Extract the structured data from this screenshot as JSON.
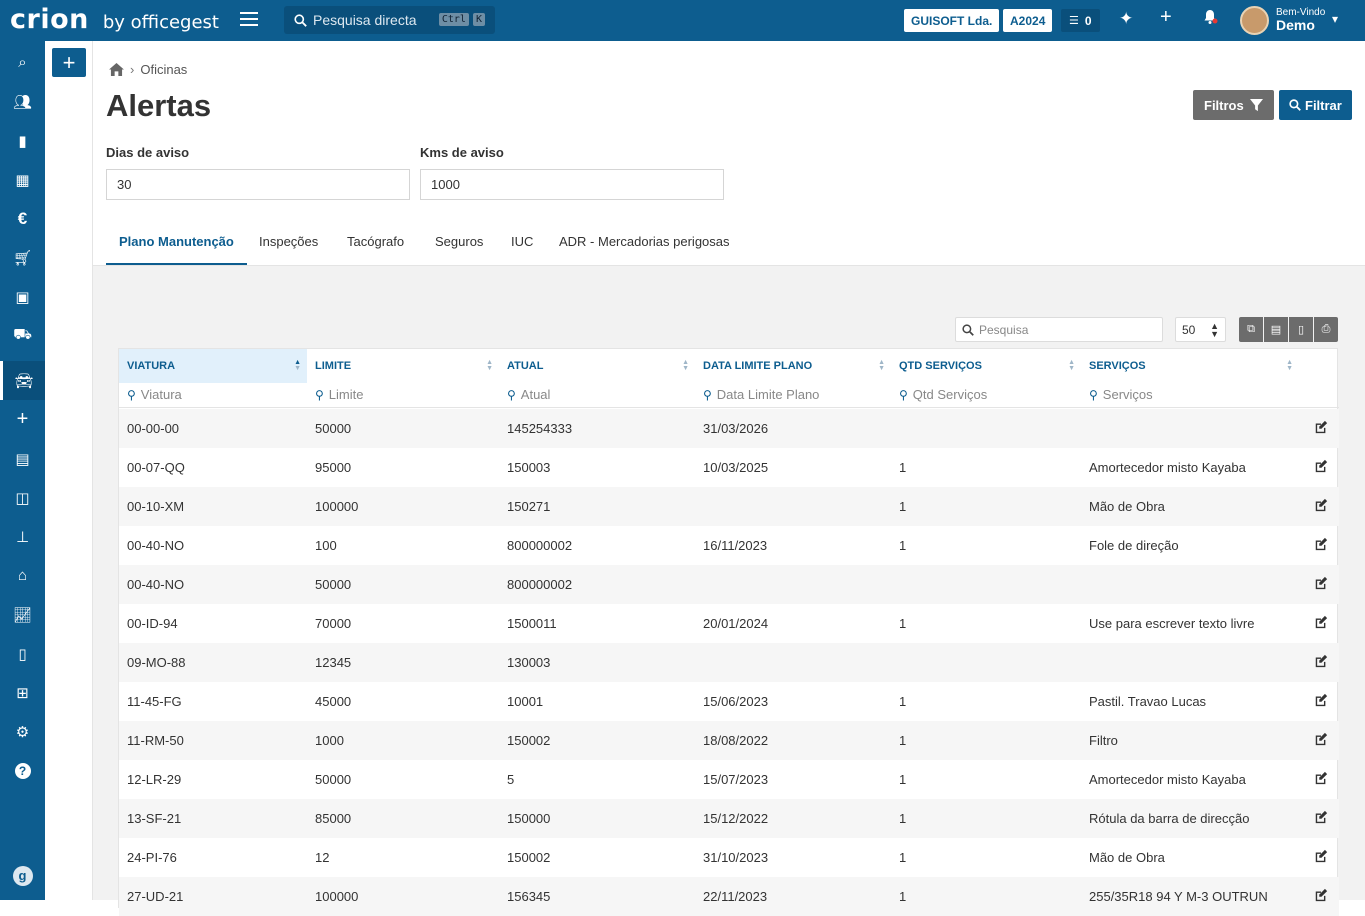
{
  "brand": {
    "name": "crion",
    "sub": "by officegest"
  },
  "topbar": {
    "search_placeholder": "Pesquisa directa",
    "kbd1": "Ctrl",
    "kbd2": "K",
    "company": "GUISOFT Lda.",
    "year": "A2024",
    "tasks_count": "0",
    "user_greeting": "Bem-Vindo",
    "user_name": "Demo"
  },
  "sidebar_icons": [
    "search-icon",
    "users-icon",
    "book-icon",
    "warehouse-icon",
    "euro-icon",
    "cart-icon",
    "money-icon",
    "car-crash-icon",
    "car-icon",
    "plus-icon",
    "calculator-icon",
    "box-icon",
    "sitemap-icon",
    "bank-icon",
    "chart-icon",
    "file-icon",
    "table-icon",
    "cogs-icon",
    "help-icon",
    "g-icon"
  ],
  "breadcrumb": {
    "home": "home",
    "current": "Oficinas"
  },
  "page_title": "Alertas",
  "buttons": {
    "filtros": "Filtros",
    "filtrar": "Filtrar"
  },
  "filters": {
    "dias_label": "Dias de aviso",
    "dias_value": "30",
    "kms_label": "Kms de aviso",
    "kms_value": "1000"
  },
  "tabs": [
    "Plano Manutenção",
    "Inspeções",
    "Tacógrafo",
    "Seguros",
    "IUC",
    "ADR - Mercadorias perigosas"
  ],
  "table_tools": {
    "search_placeholder": "Pesquisa",
    "per_page": "50"
  },
  "columns": [
    {
      "label": "VIATURA",
      "filter": "Viatura"
    },
    {
      "label": "LIMITE",
      "filter": "Limite"
    },
    {
      "label": "ATUAL",
      "filter": "Atual"
    },
    {
      "label": "DATA LIMITE PLANO",
      "filter": "Data Limite Plano"
    },
    {
      "label": "QTD SERVIÇOS",
      "filter": "Qtd Serviços"
    },
    {
      "label": "SERVIÇOS",
      "filter": "Serviços"
    }
  ],
  "rows": [
    [
      "00-00-00",
      "50000",
      "145254333",
      "31/03/2026",
      "",
      ""
    ],
    [
      "00-07-QQ",
      "95000",
      "150003",
      "10/03/2025",
      "1",
      "Amortecedor misto Kayaba"
    ],
    [
      "00-10-XM",
      "100000",
      "150271",
      "",
      "1",
      "Mão de Obra"
    ],
    [
      "00-40-NO",
      "100",
      "800000002",
      "16/11/2023",
      "1",
      "Fole de direção"
    ],
    [
      "00-40-NO",
      "50000",
      "800000002",
      "",
      "",
      ""
    ],
    [
      "00-ID-94",
      "70000",
      "1500011",
      "20/01/2024",
      "1",
      "Use para escrever texto livre"
    ],
    [
      "09-MO-88",
      "12345",
      "130003",
      "",
      "",
      ""
    ],
    [
      "11-45-FG",
      "45000",
      "10001",
      "15/06/2023",
      "1",
      "Pastil. Travao Lucas"
    ],
    [
      "11-RM-50",
      "1000",
      "150002",
      "18/08/2022",
      "1",
      "Filtro"
    ],
    [
      "12-LR-29",
      "50000",
      "5",
      "15/07/2023",
      "1",
      "Amortecedor misto Kayaba"
    ],
    [
      "13-SF-21",
      "85000",
      "150000",
      "15/12/2022",
      "1",
      "Rótula da barra de direcção"
    ],
    [
      "24-PI-76",
      "12",
      "150002",
      "31/10/2023",
      "1",
      "Mão de Obra"
    ],
    [
      "27-UD-21",
      "100000",
      "156345",
      "22/11/2023",
      "1",
      "255/35R18 94 Y M-3 OUTRUN"
    ]
  ]
}
